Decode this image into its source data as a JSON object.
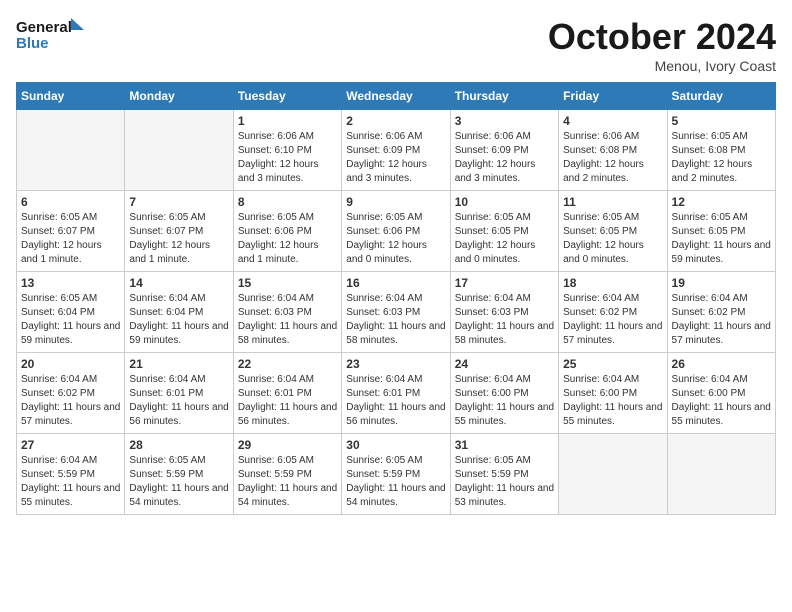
{
  "header": {
    "logo_line1": "General",
    "logo_line2": "Blue",
    "month": "October 2024",
    "location": "Menou, Ivory Coast"
  },
  "weekdays": [
    "Sunday",
    "Monday",
    "Tuesday",
    "Wednesday",
    "Thursday",
    "Friday",
    "Saturday"
  ],
  "weeks": [
    [
      {
        "day": "",
        "info": ""
      },
      {
        "day": "",
        "info": ""
      },
      {
        "day": "1",
        "info": "Sunrise: 6:06 AM\nSunset: 6:10 PM\nDaylight: 12 hours and 3 minutes."
      },
      {
        "day": "2",
        "info": "Sunrise: 6:06 AM\nSunset: 6:09 PM\nDaylight: 12 hours and 3 minutes."
      },
      {
        "day": "3",
        "info": "Sunrise: 6:06 AM\nSunset: 6:09 PM\nDaylight: 12 hours and 3 minutes."
      },
      {
        "day": "4",
        "info": "Sunrise: 6:06 AM\nSunset: 6:08 PM\nDaylight: 12 hours and 2 minutes."
      },
      {
        "day": "5",
        "info": "Sunrise: 6:05 AM\nSunset: 6:08 PM\nDaylight: 12 hours and 2 minutes."
      }
    ],
    [
      {
        "day": "6",
        "info": "Sunrise: 6:05 AM\nSunset: 6:07 PM\nDaylight: 12 hours and 1 minute."
      },
      {
        "day": "7",
        "info": "Sunrise: 6:05 AM\nSunset: 6:07 PM\nDaylight: 12 hours and 1 minute."
      },
      {
        "day": "8",
        "info": "Sunrise: 6:05 AM\nSunset: 6:06 PM\nDaylight: 12 hours and 1 minute."
      },
      {
        "day": "9",
        "info": "Sunrise: 6:05 AM\nSunset: 6:06 PM\nDaylight: 12 hours and 0 minutes."
      },
      {
        "day": "10",
        "info": "Sunrise: 6:05 AM\nSunset: 6:05 PM\nDaylight: 12 hours and 0 minutes."
      },
      {
        "day": "11",
        "info": "Sunrise: 6:05 AM\nSunset: 6:05 PM\nDaylight: 12 hours and 0 minutes."
      },
      {
        "day": "12",
        "info": "Sunrise: 6:05 AM\nSunset: 6:05 PM\nDaylight: 11 hours and 59 minutes."
      }
    ],
    [
      {
        "day": "13",
        "info": "Sunrise: 6:05 AM\nSunset: 6:04 PM\nDaylight: 11 hours and 59 minutes."
      },
      {
        "day": "14",
        "info": "Sunrise: 6:04 AM\nSunset: 6:04 PM\nDaylight: 11 hours and 59 minutes."
      },
      {
        "day": "15",
        "info": "Sunrise: 6:04 AM\nSunset: 6:03 PM\nDaylight: 11 hours and 58 minutes."
      },
      {
        "day": "16",
        "info": "Sunrise: 6:04 AM\nSunset: 6:03 PM\nDaylight: 11 hours and 58 minutes."
      },
      {
        "day": "17",
        "info": "Sunrise: 6:04 AM\nSunset: 6:03 PM\nDaylight: 11 hours and 58 minutes."
      },
      {
        "day": "18",
        "info": "Sunrise: 6:04 AM\nSunset: 6:02 PM\nDaylight: 11 hours and 57 minutes."
      },
      {
        "day": "19",
        "info": "Sunrise: 6:04 AM\nSunset: 6:02 PM\nDaylight: 11 hours and 57 minutes."
      }
    ],
    [
      {
        "day": "20",
        "info": "Sunrise: 6:04 AM\nSunset: 6:02 PM\nDaylight: 11 hours and 57 minutes."
      },
      {
        "day": "21",
        "info": "Sunrise: 6:04 AM\nSunset: 6:01 PM\nDaylight: 11 hours and 56 minutes."
      },
      {
        "day": "22",
        "info": "Sunrise: 6:04 AM\nSunset: 6:01 PM\nDaylight: 11 hours and 56 minutes."
      },
      {
        "day": "23",
        "info": "Sunrise: 6:04 AM\nSunset: 6:01 PM\nDaylight: 11 hours and 56 minutes."
      },
      {
        "day": "24",
        "info": "Sunrise: 6:04 AM\nSunset: 6:00 PM\nDaylight: 11 hours and 55 minutes."
      },
      {
        "day": "25",
        "info": "Sunrise: 6:04 AM\nSunset: 6:00 PM\nDaylight: 11 hours and 55 minutes."
      },
      {
        "day": "26",
        "info": "Sunrise: 6:04 AM\nSunset: 6:00 PM\nDaylight: 11 hours and 55 minutes."
      }
    ],
    [
      {
        "day": "27",
        "info": "Sunrise: 6:04 AM\nSunset: 5:59 PM\nDaylight: 11 hours and 55 minutes."
      },
      {
        "day": "28",
        "info": "Sunrise: 6:05 AM\nSunset: 5:59 PM\nDaylight: 11 hours and 54 minutes."
      },
      {
        "day": "29",
        "info": "Sunrise: 6:05 AM\nSunset: 5:59 PM\nDaylight: 11 hours and 54 minutes."
      },
      {
        "day": "30",
        "info": "Sunrise: 6:05 AM\nSunset: 5:59 PM\nDaylight: 11 hours and 54 minutes."
      },
      {
        "day": "31",
        "info": "Sunrise: 6:05 AM\nSunset: 5:59 PM\nDaylight: 11 hours and 53 minutes."
      },
      {
        "day": "",
        "info": ""
      },
      {
        "day": "",
        "info": ""
      }
    ]
  ]
}
